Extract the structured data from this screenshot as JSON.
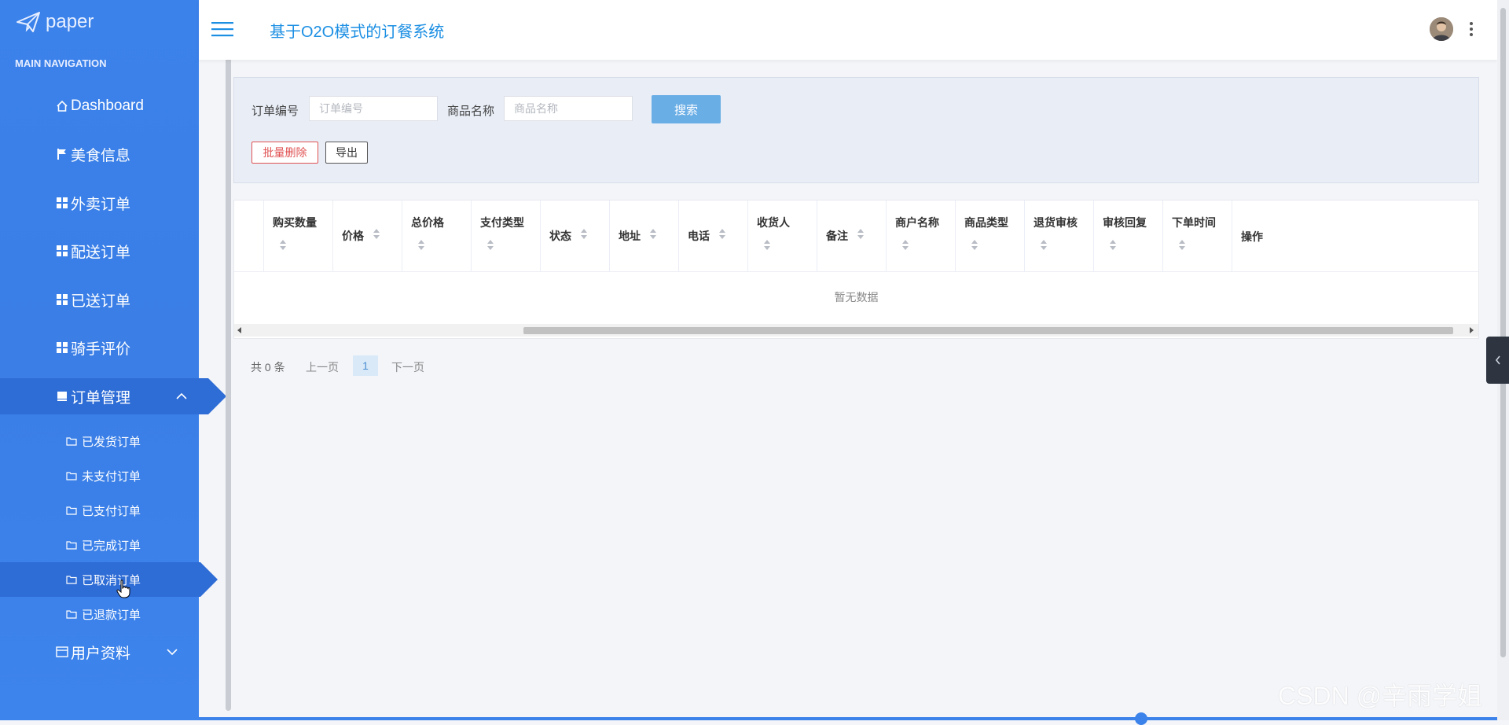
{
  "sidebar": {
    "logo_text": "paper",
    "heading": "MAIN NAVIGATION",
    "items": [
      {
        "label": "Dashboard",
        "icon": "home-icon"
      },
      {
        "label": "美食信息",
        "icon": "flag-icon"
      },
      {
        "label": "外卖订单",
        "icon": "grid-icon"
      },
      {
        "label": "配送订单",
        "icon": "grid-icon"
      },
      {
        "label": "已送订单",
        "icon": "grid-icon"
      },
      {
        "label": "骑手评价",
        "icon": "grid-icon"
      },
      {
        "label": "订单管理",
        "icon": "inbox-icon"
      }
    ],
    "submenu": [
      {
        "label": "已发货订单"
      },
      {
        "label": "未支付订单"
      },
      {
        "label": "已支付订单"
      },
      {
        "label": "已完成订单"
      },
      {
        "label": "已取消订单"
      },
      {
        "label": "已退款订单"
      }
    ],
    "user_profile_label": "用户资料"
  },
  "header": {
    "title": "基于O2O模式的订餐系统"
  },
  "search": {
    "order_no_label": "订单编号",
    "order_no_placeholder": "订单编号",
    "product_label": "商品名称",
    "product_placeholder": "商品名称",
    "search_button": "搜索",
    "batch_delete_button": "批量删除",
    "export_button": "导出"
  },
  "table": {
    "columns": [
      {
        "line1": "购买数量",
        "line2_sort": true
      },
      {
        "line1": "价格",
        "inline_sort": true
      },
      {
        "line1": "总价格",
        "line2_sort": true
      },
      {
        "line1": "支付类型",
        "line2_sort": true
      },
      {
        "line1": "状态",
        "inline_sort": true
      },
      {
        "line1": "地址",
        "inline_sort": true
      },
      {
        "line1": "电话",
        "inline_sort": true
      },
      {
        "line1": "收货人",
        "line2_sort": true
      },
      {
        "line1": "备注",
        "inline_sort": true
      },
      {
        "line1": "商户名称",
        "line2_sort": true
      },
      {
        "line1": "商品类型",
        "line2_sort": true
      },
      {
        "line1": "退货审核",
        "line2_sort": true
      },
      {
        "line1": "审核回复",
        "line2_sort": true
      },
      {
        "line1": "下单时间",
        "line2_sort": true
      },
      {
        "line1": "操作"
      }
    ],
    "empty_text": "暂无数据"
  },
  "pagination": {
    "total": "共 0 条",
    "prev": "上一页",
    "current": "1",
    "next": "下一页"
  },
  "watermark": "CSDN @辛雨学姐",
  "colors": {
    "sidebar": "#3b82ea",
    "sidebar_active": "#2e6cd6",
    "title": "#1c8fe3",
    "search_button": "#6aaee6",
    "danger": "#e05252"
  }
}
